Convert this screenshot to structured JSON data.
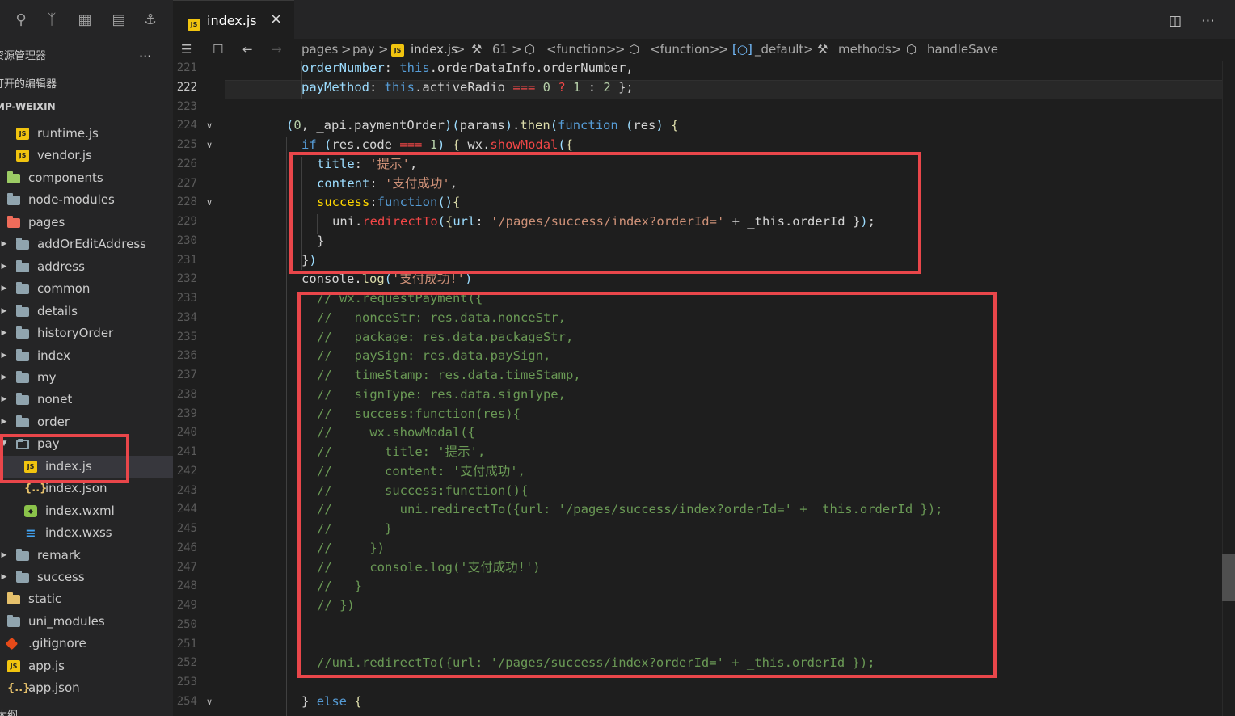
{
  "activity": {
    "icons": [
      "search-icon",
      "source-control-icon",
      "extensions-icon",
      "files-icon",
      "docker-icon"
    ]
  },
  "sidebar": {
    "explorer_title": "资源管理器",
    "more_label": "···",
    "open_editors_label": "打开的编辑器",
    "project_label": "MP-WEIXIN",
    "outline_label": "大纲",
    "items": [
      {
        "label": "runtime.js",
        "icon": "js-file-icon"
      },
      {
        "label": "vendor.js",
        "icon": "js-file-icon"
      },
      {
        "label": "components",
        "icon": "folder-green-icon"
      },
      {
        "label": "node-modules",
        "icon": "folder-icon"
      },
      {
        "label": "pages",
        "icon": "folder-red-icon"
      },
      {
        "label": "addOrEditAddress",
        "icon": "folder-icon"
      },
      {
        "label": "address",
        "icon": "folder-icon"
      },
      {
        "label": "common",
        "icon": "folder-icon"
      },
      {
        "label": "details",
        "icon": "folder-icon"
      },
      {
        "label": "historyOrder",
        "icon": "folder-icon"
      },
      {
        "label": "index",
        "icon": "folder-icon"
      },
      {
        "label": "my",
        "icon": "folder-icon"
      },
      {
        "label": "nonet",
        "icon": "folder-icon"
      },
      {
        "label": "order",
        "icon": "folder-icon"
      },
      {
        "label": "pay",
        "icon": "folder-open-icon"
      },
      {
        "label": "index.js",
        "icon": "js-file-icon"
      },
      {
        "label": "index.json",
        "icon": "json-file-icon"
      },
      {
        "label": "index.wxml",
        "icon": "wxml-file-icon"
      },
      {
        "label": "index.wxss",
        "icon": "wxss-file-icon"
      },
      {
        "label": "remark",
        "icon": "folder-icon"
      },
      {
        "label": "success",
        "icon": "folder-icon"
      },
      {
        "label": "static",
        "icon": "folder-yellow-icon"
      },
      {
        "label": "uni_modules",
        "icon": "folder-icon"
      },
      {
        "label": ".gitignore",
        "icon": "git-file-icon"
      },
      {
        "label": "app.js",
        "icon": "js-file-icon"
      },
      {
        "label": "app.json",
        "icon": "json-file-icon"
      }
    ]
  },
  "tab": {
    "label": "index.js",
    "icon_text": "JS",
    "close": "×",
    "split_icon": "split-editor-icon",
    "more_icon": "more-actions-icon"
  },
  "breadcrumb": {
    "pages": "pages",
    "pay": "pay",
    "file": "index.js",
    "line": "61",
    "fn1": "<function>",
    "fn2": "<function>",
    "default": "_default",
    "methods": "methods",
    "handler": "handleSave",
    "sep": ">"
  },
  "editor": {
    "current_line": "222",
    "line_numbers": [
      "221",
      "222",
      "223",
      "224",
      "225",
      "226",
      "227",
      "228",
      "229",
      "230",
      "231",
      "232",
      "233",
      "234",
      "235",
      "236",
      "237",
      "238",
      "239",
      "240",
      "241",
      "242",
      "243",
      "244",
      "245",
      "246",
      "247",
      "248",
      "249",
      "250",
      "251",
      "252",
      "253",
      "254"
    ],
    "lines": [
      "orderNumber: this.orderDataInfo.orderNumber,",
      "payMethod: this.activeRadio === 0 ? 1 : 2 };",
      "",
      "(0, _api.paymentOrder)(params).then(function (res) {",
      "if (res.code === 1) { wx.showModal({",
      "title: '提示',",
      "content: '支付成功',",
      "success:function(){",
      "uni.redirectTo({url: '/pages/success/index?orderId=' + _this.orderId });",
      "}",
      "})",
      "console.log('支付成功!')",
      "// wx.requestPayment({",
      "//   nonceStr: res.data.nonceStr,",
      "//   package: res.data.packageStr,",
      "//   paySign: res.data.paySign,",
      "//   timeStamp: res.data.timeStamp,",
      "//   signType: res.data.signType,",
      "//   success:function(res){",
      "//     wx.showModal({",
      "//       title: '提示',",
      "//       content: '支付成功',",
      "//       success:function(){",
      "//         uni.redirectTo({url: '/pages/success/index?orderId=' + _this.orderId });",
      "//       }",
      "//     })",
      "//     console.log('支付成功!')",
      "//   }",
      "// })",
      "",
      "",
      "//uni.redirectTo({url: '/pages/success/index?orderId=' + _this.orderId });",
      "",
      "} else {"
    ]
  },
  "colors": {
    "annotation_box": "#e9464a",
    "keyword": "#569cd6",
    "string": "#ce9178",
    "comment": "#6a9955"
  }
}
